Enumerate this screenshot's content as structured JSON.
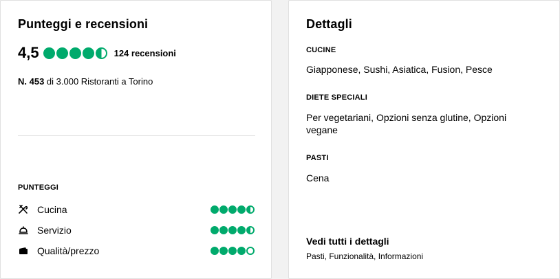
{
  "ratings_card": {
    "title": "Punteggi e recensioni",
    "overall_rating": "4,5",
    "overall_bubbles": 4.5,
    "reviews_text": "124 recensioni",
    "rank_number": "N. 453",
    "rank_text": " di 3.000 Ristoranti a Torino",
    "scores_label": "PUNTEGGI",
    "scores": [
      {
        "label": "Cucina",
        "icon": "utensils-icon",
        "rating": 4.5
      },
      {
        "label": "Servizio",
        "icon": "service-bell-icon",
        "rating": 4.5
      },
      {
        "label": "Qualità/prezzo",
        "icon": "wallet-icon",
        "rating": 4.0
      }
    ],
    "accent_color": "#00aa6c"
  },
  "details_card": {
    "title": "Dettagli",
    "cuisine_label": "CUCINE",
    "cuisine_value": "Giapponese, Sushi, Asiatica, Fusion, Pesce",
    "diet_label": "DIETE SPECIALI",
    "diet_value": "Per vegetariani, Opzioni senza glutine, Opzioni vegane",
    "meals_label": "PASTI",
    "meals_value": "Cena",
    "see_all_link": "Vedi tutti i dettagli",
    "see_all_sub": "Pasti, Funzionalità, Informazioni"
  }
}
